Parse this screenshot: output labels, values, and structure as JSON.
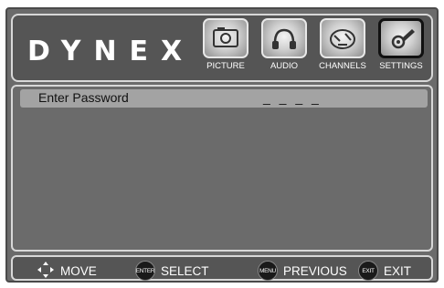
{
  "brand": {
    "logo_text": "DYNEX"
  },
  "tabs": [
    {
      "label": "PICTURE",
      "icon": "picture-icon",
      "active": false
    },
    {
      "label": "AUDIO",
      "icon": "audio-icon",
      "active": false
    },
    {
      "label": "CHANNELS",
      "icon": "channels-icon",
      "active": false
    },
    {
      "label": "SETTINGS",
      "icon": "settings-icon",
      "active": true
    }
  ],
  "menu": {
    "password_label": "Enter Password",
    "password_value": "_ _ _ _"
  },
  "footer": {
    "move_label": "MOVE",
    "select_key": "ENTER",
    "select_label": "SELECT",
    "previous_key": "MENU",
    "previous_label": "PREVIOUS",
    "exit_key": "EXIT",
    "exit_label": "EXIT"
  }
}
